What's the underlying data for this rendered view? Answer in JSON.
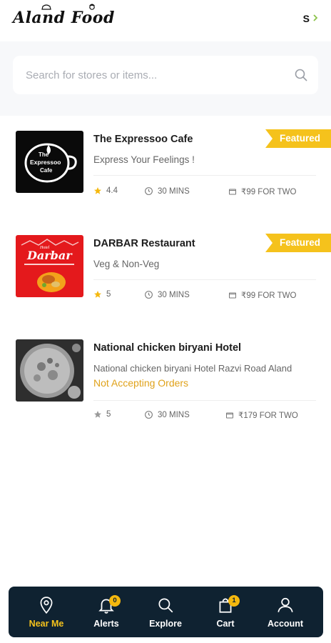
{
  "header": {
    "logo_text": "Aland Food",
    "user_initial": "S"
  },
  "search": {
    "placeholder": "Search for stores or items..."
  },
  "stores": [
    {
      "name": "The Expressoo Cafe",
      "description": "Express Your Feelings !",
      "featured_label": "Featured",
      "rating": "4.4",
      "delivery_time": "30 MINS",
      "price_for_two": "₹99 FOR TWO",
      "image_text": {
        "line1": "The",
        "line2": "Expressoo",
        "line3": "Cafe"
      }
    },
    {
      "name": "DARBAR Restaurant",
      "description": "Veg & Non-Veg",
      "featured_label": "Featured",
      "rating": "5",
      "delivery_time": "30 MINS",
      "price_for_two": "₹99 FOR TWO",
      "image_text": {
        "line1": "Hotel",
        "line2": "Darbar"
      }
    },
    {
      "name": "National chicken biryani Hotel",
      "description": "National chicken biryani Hotel Razvi Road Aland",
      "status": "Not Accepting Orders",
      "rating": "5",
      "delivery_time": "30 MINS",
      "price_for_two": "₹179 FOR TWO"
    }
  ],
  "bottom_nav": [
    {
      "label": "Near Me",
      "icon": "location-pin-icon",
      "active": true
    },
    {
      "label": "Alerts",
      "icon": "bell-icon",
      "badge": "0"
    },
    {
      "label": "Explore",
      "icon": "search-icon"
    },
    {
      "label": "Cart",
      "icon": "shopping-bag-icon",
      "badge": "1"
    },
    {
      "label": "Account",
      "icon": "user-icon"
    }
  ],
  "colors": {
    "accent": "#f5c21c",
    "nav_background": "#0f2231",
    "status_text": "#e0a21a"
  }
}
